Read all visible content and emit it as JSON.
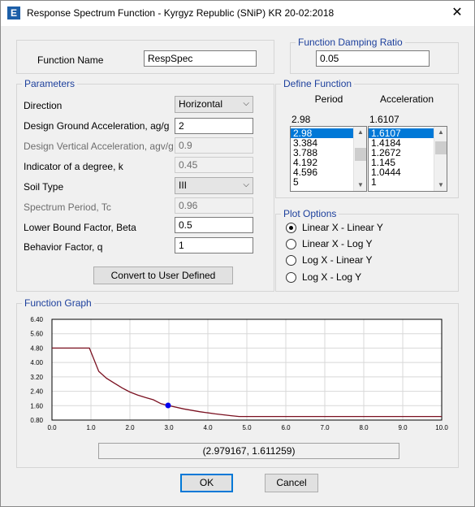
{
  "window": {
    "title": "Response Spectrum Function - Kyrgyz Republic (SNiP) KR 20-02:2018",
    "app_icon": "E",
    "close_icon": "✕"
  },
  "function_name": {
    "label": "Function Name",
    "value": "RespSpec"
  },
  "damping": {
    "title": "Function Damping Ratio",
    "value": "0.05"
  },
  "parameters": {
    "title": "Parameters",
    "direction": {
      "label": "Direction",
      "value": "Horizontal"
    },
    "ag": {
      "label": "Design Ground Acceleration, ag/g",
      "value": "2"
    },
    "agv": {
      "label": "Design Vertical Acceleration, agv/g",
      "value": "0.9"
    },
    "k": {
      "label": "Indicator of a degree, k",
      "value": "0.45"
    },
    "soil": {
      "label": "Soil Type",
      "value": "III"
    },
    "tc": {
      "label": "Spectrum Period, Tc",
      "value": "0.96"
    },
    "beta": {
      "label": "Lower Bound Factor, Beta",
      "value": "0.5"
    },
    "q": {
      "label": "Behavior Factor, q",
      "value": "1"
    },
    "convert_button": "Convert to User Defined"
  },
  "define_function": {
    "title": "Define Function",
    "period_header": "Period",
    "accel_header": "Acceleration",
    "period_edit": "2.98",
    "accel_edit": "1.6107",
    "periods": [
      "2.98",
      "3.384",
      "3.788",
      "4.192",
      "4.596",
      "5"
    ],
    "accelerations": [
      "1.6107",
      "1.4184",
      "1.2672",
      "1.145",
      "1.0444",
      "1"
    ]
  },
  "plot_options": {
    "title": "Plot Options",
    "options": [
      "Linear X - Linear Y",
      "Linear X - Log Y",
      "Log X - Linear Y",
      "Log X - Log Y"
    ],
    "selected": 0
  },
  "graph": {
    "title": "Function Graph",
    "readout": "(2.979167, 1.611259)"
  },
  "chart_data": {
    "type": "line",
    "xlim": [
      0,
      10
    ],
    "ylim": [
      0.8,
      6.4
    ],
    "x_ticks": [
      "0.0",
      "1.0",
      "2.0",
      "3.0",
      "4.0",
      "5.0",
      "6.0",
      "7.0",
      "8.0",
      "9.0",
      "10.0"
    ],
    "y_ticks": [
      "6.40",
      "5.60",
      "4.80",
      "4.00",
      "3.20",
      "2.40",
      "1.60",
      "0.80"
    ],
    "grid": true,
    "series": [
      {
        "color": "#7a1020",
        "x": [
          0,
          0.96,
          1.2,
          1.4,
          1.6,
          1.8,
          2.0,
          2.2,
          2.4,
          2.6,
          2.8,
          2.98,
          3.384,
          3.788,
          4.192,
          4.596,
          4.8,
          5.0,
          10.0
        ],
        "y": [
          4.8,
          4.8,
          3.51,
          3.12,
          2.85,
          2.59,
          2.36,
          2.19,
          2.05,
          1.93,
          1.71,
          1.6107,
          1.4184,
          1.2672,
          1.145,
          1.0444,
          1.0,
          1.0,
          1.0
        ]
      }
    ],
    "marker": {
      "x": 2.979167,
      "y": 1.611259,
      "color": "#0000ee"
    }
  },
  "buttons": {
    "ok": "OK",
    "cancel": "Cancel"
  }
}
